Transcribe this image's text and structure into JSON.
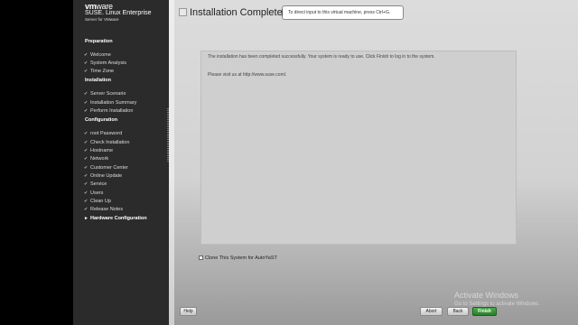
{
  "brand": {
    "vendor_bold": "vm",
    "vendor_rest": "ware",
    "product": "SUSE. Linux Enterprise",
    "edition": "Server for VMware"
  },
  "sidebar": {
    "sections": [
      {
        "title": "Preparation",
        "steps": [
          {
            "label": "Welcome",
            "status": "done"
          },
          {
            "label": "System Analysis",
            "status": "done"
          },
          {
            "label": "Time Zone",
            "status": "done"
          }
        ]
      },
      {
        "title": "Installation",
        "steps": [
          {
            "label": "Server Scenario",
            "status": "done"
          },
          {
            "label": "Installation Summary",
            "status": "done"
          },
          {
            "label": "Perform Installation",
            "status": "done"
          }
        ]
      },
      {
        "title": "Configuration",
        "steps": [
          {
            "label": "root Password",
            "status": "done"
          },
          {
            "label": "Check Installation",
            "status": "done"
          },
          {
            "label": "Hostname",
            "status": "done"
          },
          {
            "label": "Network",
            "status": "done"
          },
          {
            "label": "Customer Center",
            "status": "done"
          },
          {
            "label": "Online Update",
            "status": "done"
          },
          {
            "label": "Service",
            "status": "done"
          },
          {
            "label": "Users",
            "status": "done"
          },
          {
            "label": "Clean Up",
            "status": "done"
          },
          {
            "label": "Release Notes",
            "status": "done"
          },
          {
            "label": "Hardware Configuration",
            "status": "current"
          }
        ]
      }
    ]
  },
  "header": {
    "title": "Installation Completed",
    "tooltip": "To direct input to this virtual machine, press Ctrl+G."
  },
  "content": {
    "message": "The installation has been completed successfully. Your system is ready to use. Click Finish to log in to the system.",
    "visit": "Please visit us at http://www.suse.com/.",
    "clone_label": "Clone This System for AutoYaST",
    "clone_checked": false
  },
  "buttons": {
    "help": "Help",
    "abort": "Abort",
    "back": "Back",
    "finish": "Finish"
  },
  "watermark": {
    "line1": "Activate Windows",
    "line2": "Go to Settings to activate Windows."
  }
}
